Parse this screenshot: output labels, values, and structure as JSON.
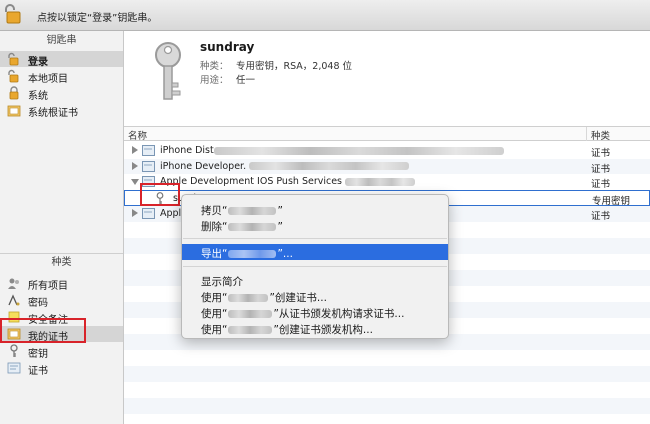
{
  "topbar": {
    "hint": "点按以锁定“登录”钥匙串。"
  },
  "sidebar": {
    "keychains_header": "钥匙串",
    "keychains": [
      {
        "label": "登录",
        "icon": "unlocked-padlock-icon",
        "selected": true
      },
      {
        "label": "本地项目",
        "icon": "unlocked-padlock-icon"
      },
      {
        "label": "系统",
        "icon": "locked-padlock-icon"
      },
      {
        "label": "系统根证书",
        "icon": "certificate-folder-icon"
      }
    ],
    "categories_header": "种类",
    "categories": [
      {
        "label": "所有项目",
        "icon": "people-icon"
      },
      {
        "label": "密码",
        "icon": "password-icon"
      },
      {
        "label": "安全备注",
        "icon": "note-icon"
      },
      {
        "label": "我的证书",
        "icon": "my-certificate-icon",
        "selected": true
      },
      {
        "label": "密钥",
        "icon": "key-icon"
      },
      {
        "label": "证书",
        "icon": "certificate-icon"
      }
    ]
  },
  "info": {
    "name": "sundray",
    "kind_label": "种类：",
    "kind_value": "专用密钥，RSA，2,048 位",
    "usage_label": "用途：",
    "usage_value": "任一"
  },
  "table": {
    "col_name": "名称",
    "col_kind": "种类",
    "rows": [
      {
        "name": "iPhone Dist",
        "kind": "证书",
        "expander": "closed",
        "blurred_suffix": true
      },
      {
        "name": "iPhone Developer.",
        "kind": "证书",
        "expander": "closed",
        "blurred_suffix": true
      },
      {
        "name": "Apple Development IOS Push Services",
        "kind": "证书",
        "expander": "open",
        "blurred_suffix": true
      },
      {
        "name": "sundray",
        "kind": "专用密钥",
        "child": true,
        "selected": true
      },
      {
        "name": "Apple",
        "kind": "证书",
        "expander": "closed",
        "blurred_suffix": true
      }
    ]
  },
  "context_menu": {
    "items": [
      {
        "prefix": "拷贝“",
        "suffix": "”"
      },
      {
        "prefix": "删除“",
        "suffix": "”"
      },
      {
        "prefix": "导出“",
        "suffix": "”...",
        "highlighted": true
      },
      {
        "text": "显示简介"
      },
      {
        "prefix": "使用“",
        "suffix": "”创建证书..."
      },
      {
        "prefix": "使用“",
        "suffix": "”从证书颁发机构请求证书..."
      },
      {
        "prefix": "使用“",
        "suffix": "”创建证书颁发机构..."
      }
    ]
  },
  "colors": {
    "highlight": "#2b6de0",
    "annotation_red": "#d8232a",
    "selection_border": "#2f6fcf"
  }
}
